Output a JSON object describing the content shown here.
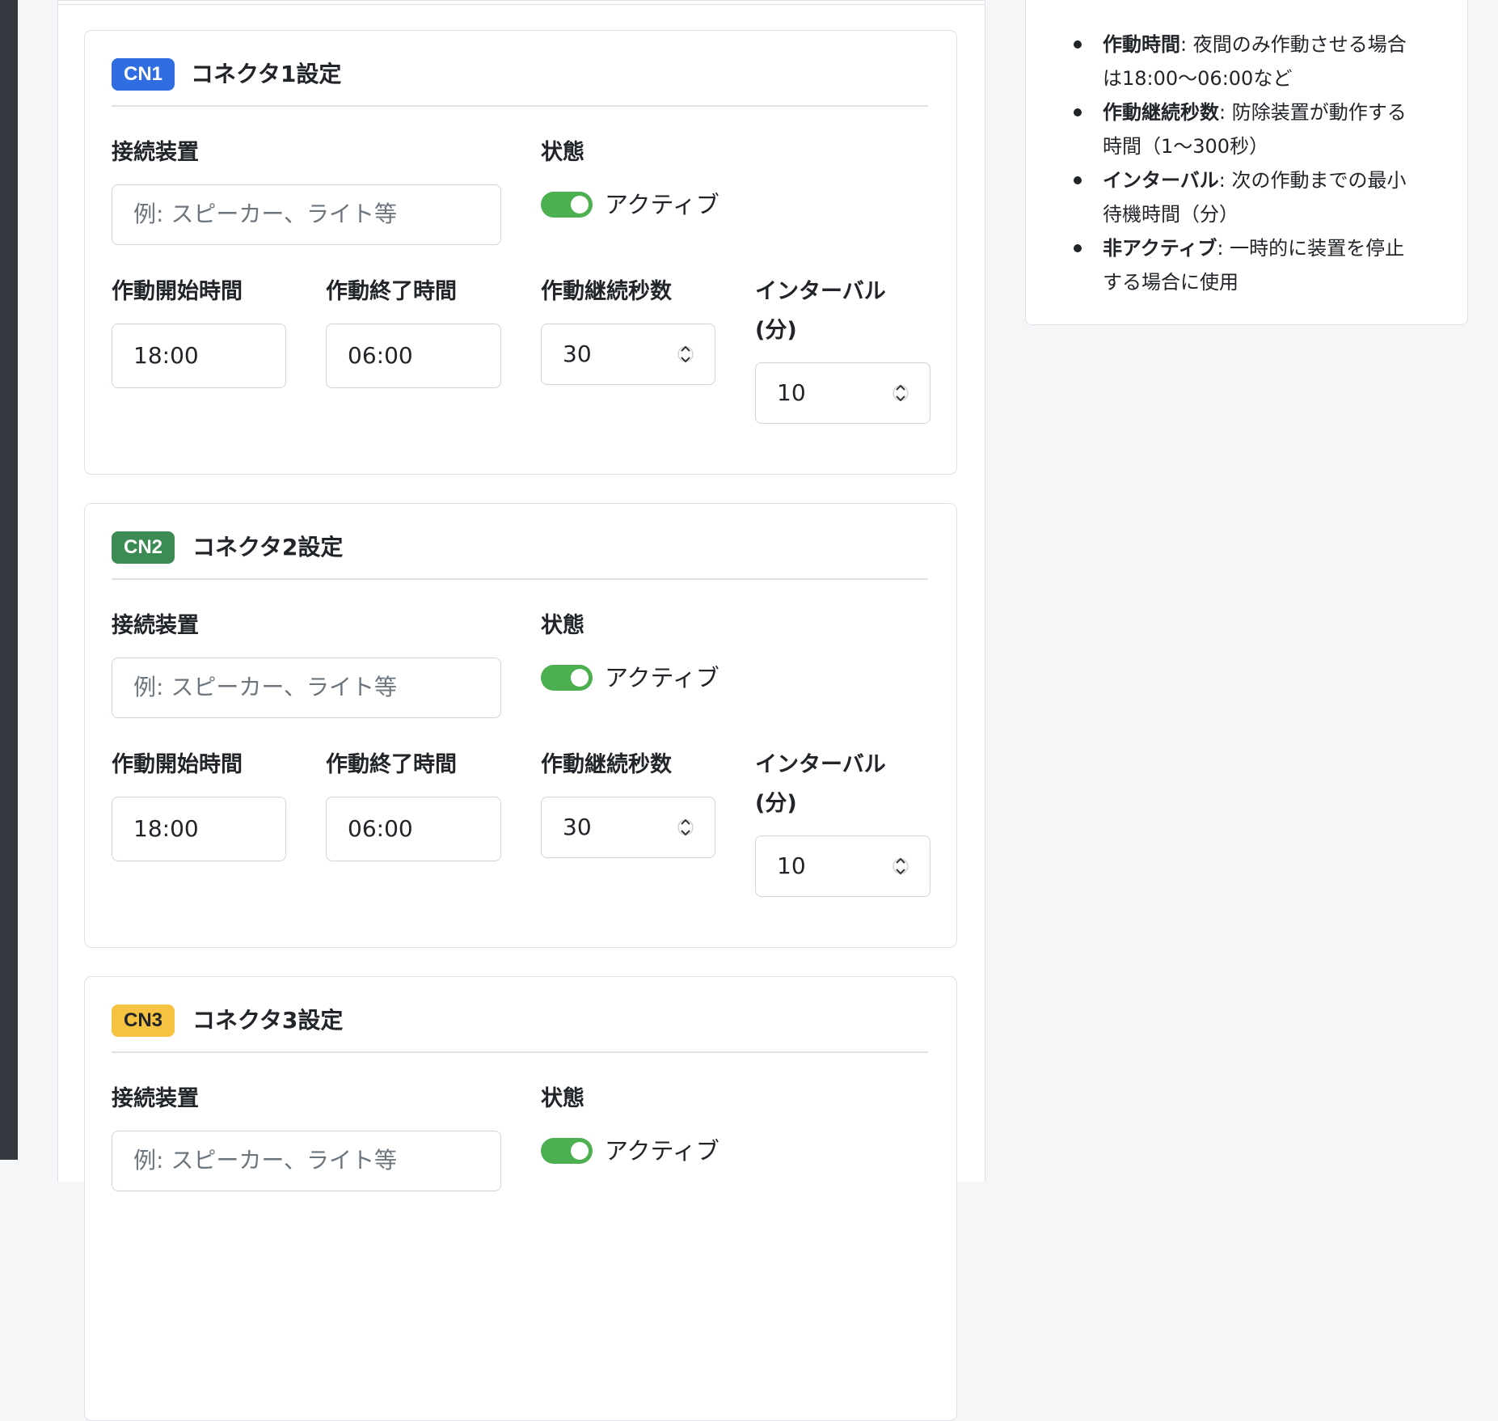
{
  "connectors": [
    {
      "badge": "CN1",
      "badge_color": "#2f6de1",
      "title": "コネクタ1設定",
      "device_label": "接続装置",
      "device_placeholder": "例: スピーカー、ライト等",
      "status_label": "状態",
      "status_text": "アクティブ",
      "start_label": "作動開始時間",
      "start_value": "18:00",
      "end_label": "作動終了時間",
      "end_value": "06:00",
      "duration_label": "作動継続秒数",
      "duration_value": "30",
      "interval_label_1": "インターバル",
      "interval_label_2": "(分)",
      "interval_value": "10"
    },
    {
      "badge": "CN2",
      "badge_color": "#3d8b54",
      "title": "コネクタ2設定",
      "device_label": "接続装置",
      "device_placeholder": "例: スピーカー、ライト等",
      "status_label": "状態",
      "status_text": "アクティブ",
      "start_label": "作動開始時間",
      "start_value": "18:00",
      "end_label": "作動終了時間",
      "end_value": "06:00",
      "duration_label": "作動継続秒数",
      "duration_value": "30",
      "interval_label_1": "インターバル",
      "interval_label_2": "(分)",
      "interval_value": "10"
    },
    {
      "badge": "CN3",
      "badge_color": "#f5c242",
      "title": "コネクタ3設定",
      "device_label": "接続装置",
      "device_placeholder": "例: スピーカー、ライト等",
      "status_label": "状態",
      "status_text": "アクティブ"
    }
  ],
  "help": [
    {
      "term": "作動時間",
      "desc_1": ": 夜間のみ作動させる場合",
      "desc_2": "は18:00〜06:00など"
    },
    {
      "term": "作動継続秒数",
      "desc_1": ": 防除装置が動作する",
      "desc_2": "時間（1〜300秒）"
    },
    {
      "term": "インターバル",
      "desc_1": ": 次の作動までの最小",
      "desc_2": "待機時間（分）"
    },
    {
      "term": "非アクティブ",
      "desc_1": ": 一時的に装置を停止",
      "desc_2": "する場合に使用"
    }
  ]
}
